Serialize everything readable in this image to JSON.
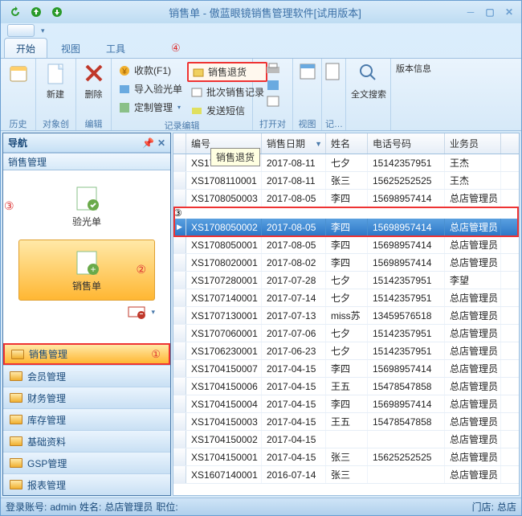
{
  "title": "销售单 - 傲蓝眼镜销售管理软件[试用版本]",
  "tabs": {
    "t0": "开始",
    "t1": "视图",
    "t2": "工具",
    "marker4": "④"
  },
  "ribbon": {
    "history": "历史",
    "new": "新建",
    "create": "对象创建",
    "delete": "删除",
    "edit": "编辑",
    "receipt": "收款(F1)",
    "return": "销售退货",
    "importOD": "导入验光单",
    "batchRec": "批次销售记录",
    "customMgr": "定制管理",
    "sendSms": "发送短信",
    "recEdit": "记录编辑",
    "openObj": "打开对象",
    "view": "视图",
    "log": "记…",
    "fullsearch": "全文搜索",
    "version": "版本信息"
  },
  "nav": {
    "title": "导航",
    "section": "销售管理",
    "card1": "验光单",
    "card2": "销售单",
    "marker3": "③",
    "marker2": "②",
    "marker1": "①",
    "items": [
      "销售管理",
      "会员管理",
      "财务管理",
      "库存管理",
      "基础资料",
      "GSP管理",
      "报表管理"
    ]
  },
  "grid": {
    "cols": {
      "c1": "编号",
      "c2": "销售日期",
      "c3": "姓名",
      "c4": "电话号码",
      "c5": "业务员"
    },
    "tooltip": "销售退货",
    "rows": [
      {
        "id": "XS1708110002",
        "date": "2017-08-11",
        "name": "七夕",
        "phone": "15142357951",
        "emp": "王杰"
      },
      {
        "id": "XS1708110001",
        "date": "2017-08-11",
        "name": "张三",
        "phone": "15625252525",
        "emp": "王杰"
      },
      {
        "id": "XS1708050003",
        "date": "2017-08-05",
        "name": "李四",
        "phone": "15698957414",
        "emp": "总店管理员"
      },
      {
        "id": "XS1708050002",
        "date": "2017-08-05",
        "name": "李四",
        "phone": "15698957414",
        "emp": "总店管理员"
      },
      {
        "id": "XS1708050001",
        "date": "2017-08-05",
        "name": "李四",
        "phone": "15698957414",
        "emp": "总店管理员"
      },
      {
        "id": "XS1708020001",
        "date": "2017-08-02",
        "name": "李四",
        "phone": "15698957414",
        "emp": "总店管理员"
      },
      {
        "id": "XS1707280001",
        "date": "2017-07-28",
        "name": "七夕",
        "phone": "15142357951",
        "emp": "李望"
      },
      {
        "id": "XS1707140001",
        "date": "2017-07-14",
        "name": "七夕",
        "phone": "15142357951",
        "emp": "总店管理员"
      },
      {
        "id": "XS1707130001",
        "date": "2017-07-13",
        "name": "miss苏",
        "phone": "13459576518",
        "emp": "总店管理员"
      },
      {
        "id": "XS1707060001",
        "date": "2017-07-06",
        "name": "七夕",
        "phone": "15142357951",
        "emp": "总店管理员"
      },
      {
        "id": "XS1706230001",
        "date": "2017-06-23",
        "name": "七夕",
        "phone": "15142357951",
        "emp": "总店管理员"
      },
      {
        "id": "XS1704150007",
        "date": "2017-04-15",
        "name": "李四",
        "phone": "15698957414",
        "emp": "总店管理员"
      },
      {
        "id": "XS1704150006",
        "date": "2017-04-15",
        "name": "王五",
        "phone": "15478547858",
        "emp": "总店管理员"
      },
      {
        "id": "XS1704150004",
        "date": "2017-04-15",
        "name": "李四",
        "phone": "15698957414",
        "emp": "总店管理员"
      },
      {
        "id": "XS1704150003",
        "date": "2017-04-15",
        "name": "王五",
        "phone": "15478547858",
        "emp": "总店管理员"
      },
      {
        "id": "XS1704150002",
        "date": "2017-04-15",
        "name": "",
        "phone": "",
        "emp": "总店管理员"
      },
      {
        "id": "XS1704150001",
        "date": "2017-04-15",
        "name": "张三",
        "phone": "15625252525",
        "emp": "总店管理员"
      },
      {
        "id": "XS1607140001",
        "date": "2016-07-14",
        "name": "张三",
        "phone": "",
        "emp": "总店管理员"
      }
    ],
    "selectedIndex": 3
  },
  "status": {
    "account_lbl": "登录账号:",
    "account": "admin",
    "name_lbl": "姓名:",
    "name": "总店管理员",
    "role_lbl": "职位:",
    "store_lbl": "门店:",
    "store": "总店"
  }
}
